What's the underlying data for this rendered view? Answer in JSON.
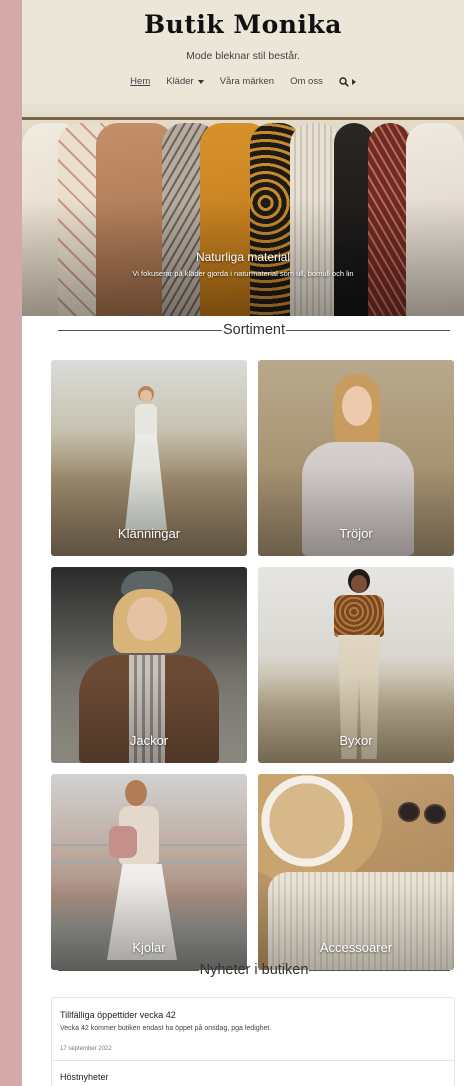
{
  "brand": {
    "name": "Butik Monika",
    "tagline": "Mode bleknar stil består."
  },
  "nav": {
    "items": [
      {
        "label": "Hem",
        "active": true
      },
      {
        "label": "Kläder",
        "dropdown": true
      },
      {
        "label": "Våra märken"
      },
      {
        "label": "Om oss"
      }
    ],
    "search_icon": "search-icon"
  },
  "hero": {
    "title": "Naturliga material",
    "subtitle": "Vi fokuserar på kläder gjorda i naturmaterial som ull, bomull och lin"
  },
  "assortment": {
    "heading": "Sortiment",
    "categories": [
      {
        "label": "Klänningar"
      },
      {
        "label": "Tröjor"
      },
      {
        "label": "Jackor"
      },
      {
        "label": "Byxor"
      },
      {
        "label": "Kjolar"
      },
      {
        "label": "Accessoarer"
      }
    ]
  },
  "news": {
    "heading": "Nyheter i butiken",
    "items": [
      {
        "title": "Tillfälliga öppettider vecka 42",
        "body": "Vecka 42 kommer butiken endast ha öppet på onsdag, pga ledighet.",
        "date": "17 september 2022"
      },
      {
        "title": "Höstnyheter"
      }
    ]
  },
  "colors": {
    "background": "#d4a9a9",
    "header": "#ece6d9"
  }
}
